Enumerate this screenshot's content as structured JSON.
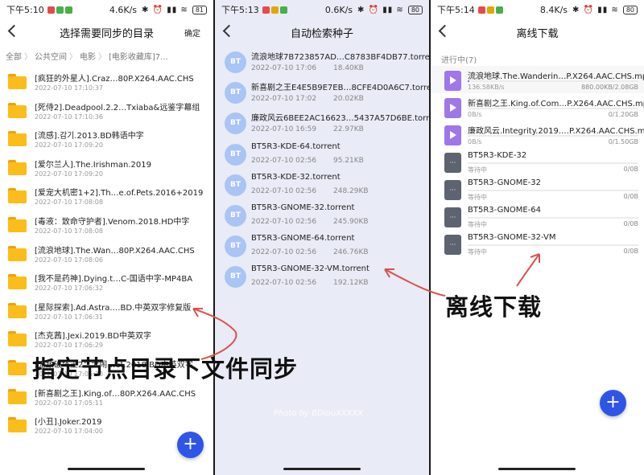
{
  "colors": {
    "accent": "#2f55e8",
    "folder": "#fbbd19",
    "bt_badge": "#a9c4f5",
    "video_icon": "#9f77e8",
    "file_icon": "#5d6370",
    "progress": "#5d7ef0",
    "annotation_arrow": "#d9534f"
  },
  "screens": [
    {
      "status": {
        "time": "下午5:10",
        "speed": "4.6K/s",
        "icons": "✱ ⏰ ▮▮ ≋",
        "battery": "81"
      },
      "title": "选择需要同步的目录",
      "action": "确定",
      "breadcrumb": [
        "全部",
        "公共空间",
        "电影",
        "[电影收藏库]7..."
      ],
      "folders": [
        {
          "name": "[疯狂的外星人].Craz…80P.X264.AAC.CHS",
          "date": "2022-07-10 17:10:37"
        },
        {
          "name": "[死侍2].Deadpool.2.2…Txiaba&远鉴字幕组",
          "date": "2022-07-10 17:10:36"
        },
        {
          "name": "[流感].감기.2013.BD韩语中字",
          "date": "2022-07-10 17:09:20"
        },
        {
          "name": "[爱尔兰人].The.Irishman.2019",
          "date": "2022-07-10 17:09:20"
        },
        {
          "name": "[爱宠大机密1+2].Th…e.of.Pets.2016+2019",
          "date": "2022-07-10 17:08:08"
        },
        {
          "name": "[毒液：致命守护者].Venom.2018.HD中字",
          "date": "2022-07-10 17:08:08"
        },
        {
          "name": "[流浪地球].The.Wan…80P.X264.AAC.CHS",
          "date": "2022-07-10 17:08:06"
        },
        {
          "name": "[我不是药神].Dying.t…C-国语中字-MP4BA",
          "date": "2022-07-10 17:06:32"
        },
        {
          "name": "[星际探索].Ad.Astra.…BD.中英双字修复版",
          "date": "2022-07-10 17:06:31"
        },
        {
          "name": "[杰克茜].Jexi.2019.BD中英双字",
          "date": "2022-07-10 17:06:29"
        },
        {
          "name": "[无敌破坏王2：大闹…et.2018.BD中英双字",
          "date": "2022-07-10 17:05:30"
        },
        {
          "name": "[新喜剧之王].King.of…80P.X264.AAC.CHS",
          "date": "2022-07-10 17:05:11"
        },
        {
          "name": "[小丑].Joker.2019",
          "date": "2022-07-10 17:04:00"
        }
      ],
      "fab": "+"
    },
    {
      "status": {
        "time": "下午5:13",
        "speed": "0.6K/s",
        "icons": "✱ ⏰ ▮▮ ≋",
        "battery": "80"
      },
      "title": "自动检索种子",
      "badge": "BT",
      "torrents": [
        {
          "name": "流浪地球7B723857AD…C8783BF4DB77.torrent",
          "date": "2022-07-10 17:06",
          "size": "18.40KB"
        },
        {
          "name": "新喜剧之王E4E5B9E7EB…8CFE4D0A6C7.torrent",
          "date": "2022-07-10 17:02",
          "size": "20.02KB"
        },
        {
          "name": "廉政风云6BEE2AC16623…5437A57D6BE.torrent",
          "date": "2022-07-10 16:59",
          "size": "22.97KB"
        },
        {
          "name": "BT5R3-KDE-64.torrent",
          "date": "2022-07-10 02:56",
          "size": "95.21KB"
        },
        {
          "name": "BT5R3-KDE-32.torrent",
          "date": "2022-07-10 02:56",
          "size": "248.29KB"
        },
        {
          "name": "BT5R3-GNOME-32.torrent",
          "date": "2022-07-10 02:56",
          "size": "245.90KB"
        },
        {
          "name": "BT5R3-GNOME-64.torrent",
          "date": "2022-07-10 02:56",
          "size": "246.76KB"
        },
        {
          "name": "BT5R3-GNOME-32-VM.torrent",
          "date": "2022-07-10 02:56",
          "size": "192.12KB"
        }
      ],
      "watermark": "Photo by BDlouXXXXX"
    },
    {
      "status": {
        "time": "下午5:14",
        "speed": "8.4K/s",
        "icons": "✱ ⏰ ▮▮ ≋",
        "battery": "80"
      },
      "title": "离线下载",
      "section": "进行中(7)",
      "downloads": [
        {
          "name": "流浪地球.The.Wanderin…P.X264.AAC.CHS.mp4",
          "status": "136.58KB/s",
          "size": "880.00KB/2.08GB",
          "kind": "video",
          "progress": 0.0004
        },
        {
          "name": "新喜剧之王.King.of.Com…P.X264.AAC.CHS.mp4",
          "status": "0B/s",
          "size": "0/1.20GB",
          "kind": "video",
          "progress": 0
        },
        {
          "name": "廉政风云.Integrity.2019.…P.X264.AAC.CHS.mp4",
          "status": "0B/s",
          "size": "0/1.50GB",
          "kind": "video",
          "progress": 0
        },
        {
          "name": "BT5R3-KDE-32",
          "status": "等待中",
          "size": "0/0B",
          "kind": "file",
          "progress": 0
        },
        {
          "name": "BT5R3-GNOME-32",
          "status": "等待中",
          "size": "0/0B",
          "kind": "file",
          "progress": 0
        },
        {
          "name": "BT5R3-GNOME-64",
          "status": "等待中",
          "size": "0/0B",
          "kind": "file",
          "progress": 0
        },
        {
          "name": "BT5R3-GNOME-32-VM",
          "status": "等待中",
          "size": "0/0B",
          "kind": "file",
          "progress": 0
        }
      ],
      "file_glyph": "···",
      "fab": "+"
    }
  ],
  "annotations": {
    "caption_left": "指定节点目录下文件同步",
    "caption_right": "离线下载"
  }
}
